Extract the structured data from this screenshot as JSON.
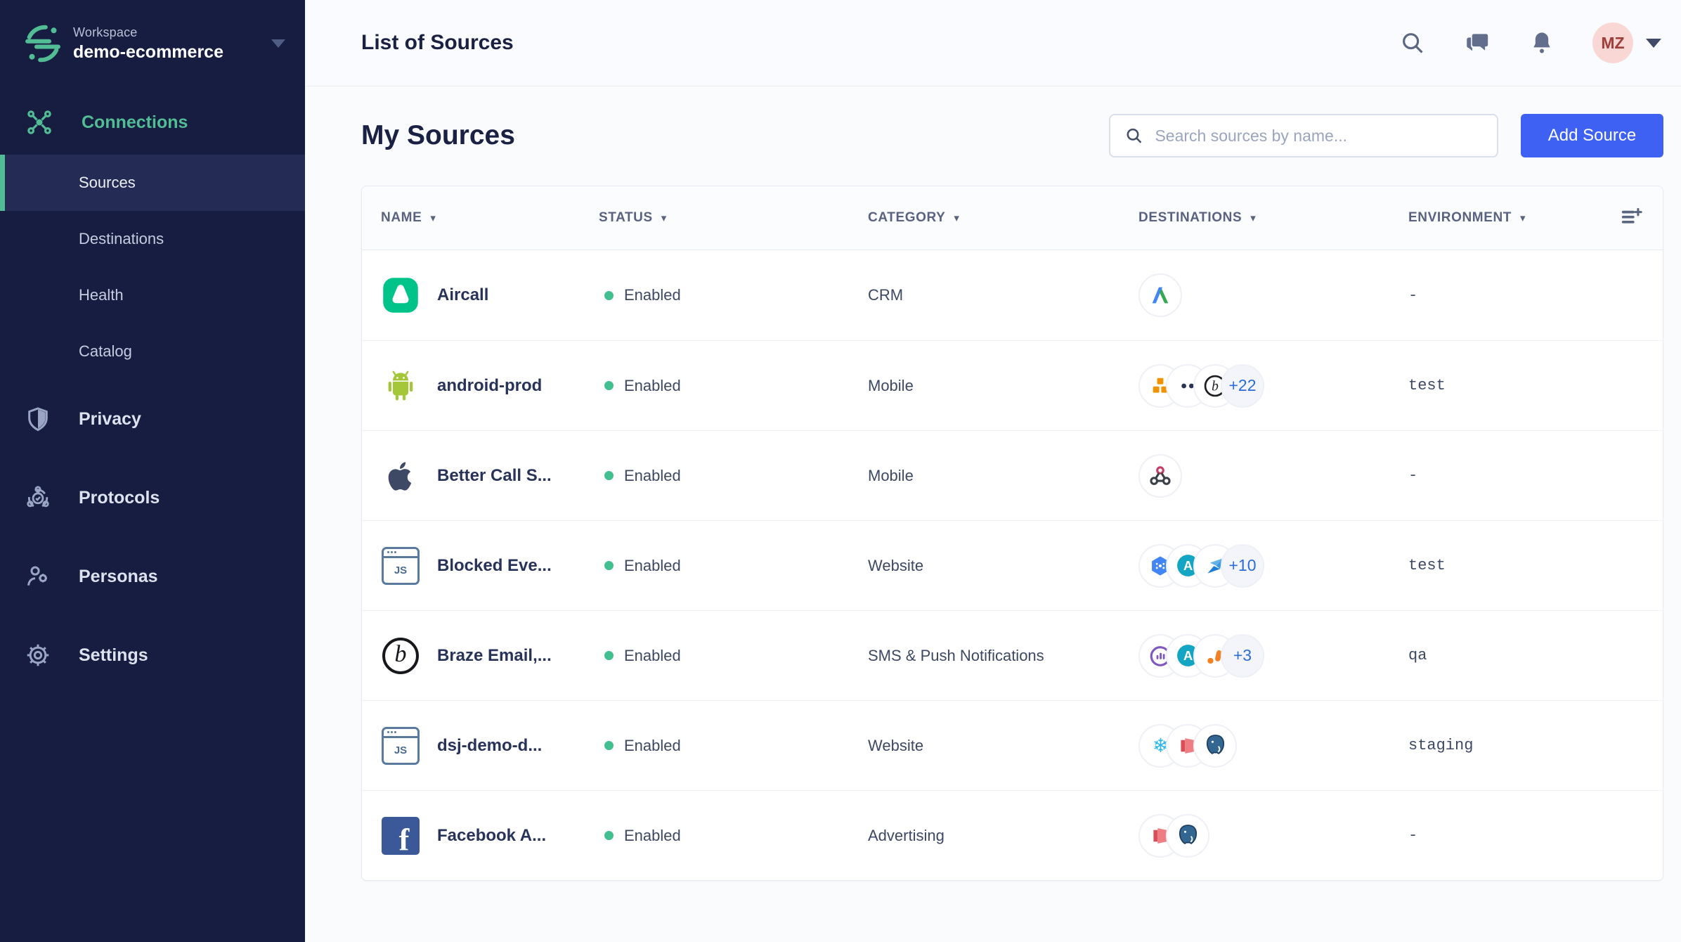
{
  "workspace": {
    "label": "Workspace",
    "name": "demo-ecommerce"
  },
  "sidebar": {
    "sections": [
      {
        "label": "Connections",
        "icon": "connections-icon",
        "active": true,
        "children": [
          {
            "label": "Sources",
            "active": true
          },
          {
            "label": "Destinations",
            "active": false
          },
          {
            "label": "Health",
            "active": false
          },
          {
            "label": "Catalog",
            "active": false
          }
        ]
      },
      {
        "label": "Privacy",
        "icon": "shield-icon"
      },
      {
        "label": "Protocols",
        "icon": "protocols-icon"
      },
      {
        "label": "Personas",
        "icon": "personas-icon"
      },
      {
        "label": "Settings",
        "icon": "gear-icon"
      }
    ]
  },
  "topbar": {
    "title": "List of Sources",
    "icons": [
      "search-icon",
      "chat-icon",
      "bell-icon"
    ],
    "avatar_initials": "MZ"
  },
  "main": {
    "heading": "My Sources",
    "search_placeholder": "Search sources by name...",
    "add_button": "Add Source"
  },
  "table": {
    "columns": [
      "NAME",
      "STATUS",
      "CATEGORY",
      "DESTINATIONS",
      "ENVIRONMENT"
    ],
    "rows": [
      {
        "name": "Aircall",
        "icon": "aircall",
        "status": "Enabled",
        "category": "CRM",
        "destinations": [
          "adwords"
        ],
        "more": null,
        "environment": "-"
      },
      {
        "name": "android-prod",
        "icon": "android",
        "status": "Enabled",
        "category": "Mobile",
        "destinations": [
          "aws",
          "dots",
          "circleb"
        ],
        "more": "+22",
        "environment": "test"
      },
      {
        "name": "Better Call S...",
        "icon": "apple",
        "status": "Enabled",
        "category": "Mobile",
        "destinations": [
          "webhook"
        ],
        "more": null,
        "environment": "-"
      },
      {
        "name": "Blocked Eve...",
        "icon": "javascript",
        "status": "Enabled",
        "category": "Website",
        "destinations": [
          "gcp",
          "amplitude",
          "ribbon"
        ],
        "more": "+10",
        "environment": "test"
      },
      {
        "name": "Braze Email,...",
        "icon": "braze",
        "status": "Enabled",
        "category": "SMS & Push Notifications",
        "destinations": [
          "heap",
          "amplitude",
          "hotjar"
        ],
        "more": "+3",
        "environment": "qa"
      },
      {
        "name": "dsj-demo-d...",
        "icon": "javascript",
        "status": "Enabled",
        "category": "Website",
        "destinations": [
          "snowflake",
          "redshift",
          "postgres"
        ],
        "more": null,
        "environment": "staging"
      },
      {
        "name": "Facebook A...",
        "icon": "facebook",
        "status": "Enabled",
        "category": "Advertising",
        "destinations": [
          "redshift",
          "postgres"
        ],
        "more": null,
        "environment": "-"
      }
    ]
  },
  "colors": {
    "sidebar_bg": "#161d40",
    "accent_green": "#52bd94",
    "button_blue": "#3e61f4",
    "enabled_dot": "#43bf8f",
    "badge_blue": "#2b6cd9",
    "avatar_bg": "#f8d7d4",
    "avatar_text": "#a03e3b"
  }
}
